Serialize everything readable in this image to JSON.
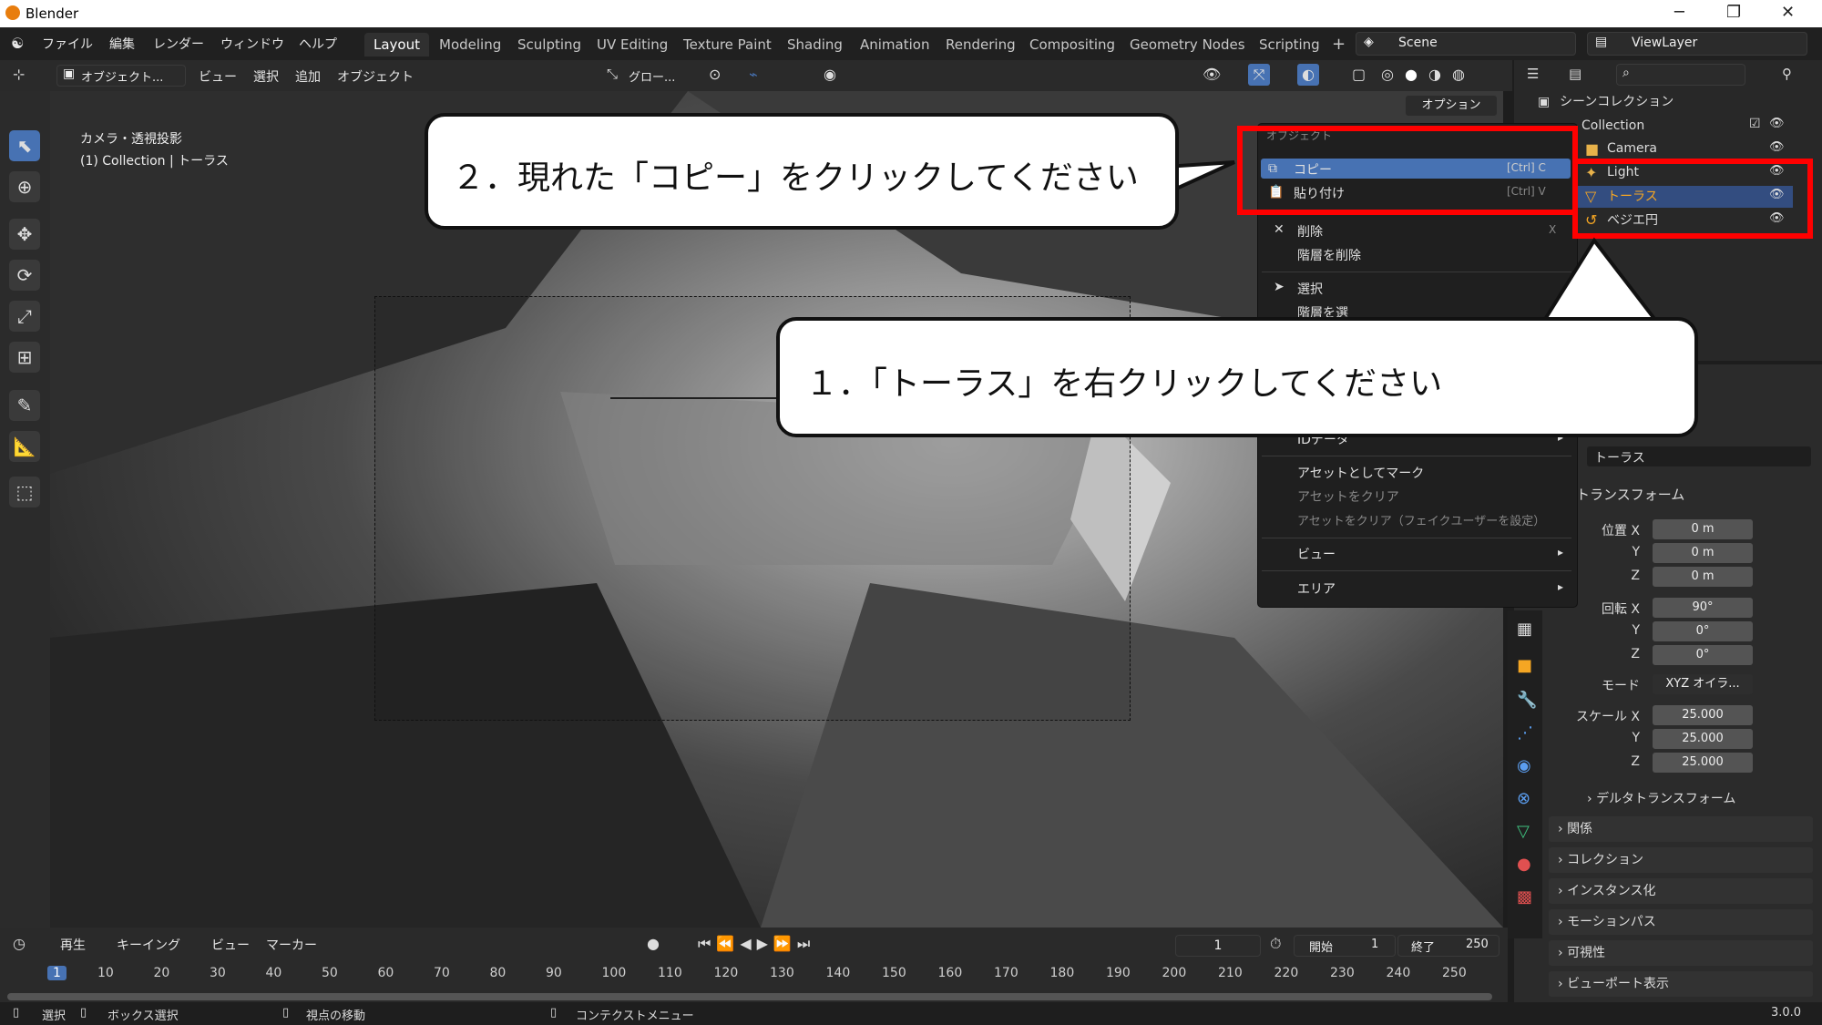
{
  "window": {
    "title": "Blender",
    "controls": [
      "─",
      "❐",
      "✕"
    ]
  },
  "menubar": {
    "menus": [
      "ファイル",
      "編集",
      "レンダー",
      "ウィンドウ",
      "ヘルプ"
    ],
    "workspaces": [
      "Layout",
      "Modeling",
      "Sculpting",
      "UV Editing",
      "Texture Paint",
      "Shading",
      "Animation",
      "Rendering",
      "Compositing",
      "Geometry Nodes",
      "Scripting"
    ],
    "active_workspace": "Layout",
    "add_tab": "+",
    "scene": "Scene",
    "view_layer": "ViewLayer"
  },
  "viewport_header": {
    "mode": "オブジェクト...",
    "menus": [
      "ビュー",
      "選択",
      "追加",
      "オブジェクト"
    ],
    "transform_orientation": "グロー...",
    "options": "オプション"
  },
  "viewport": {
    "info_line1": "カメラ・透視投影",
    "info_line2": "(1) Collection | トーラス"
  },
  "outliner": {
    "root": "シーンコレクション",
    "items": [
      {
        "label": "Collection",
        "icon": "collection-icon"
      },
      {
        "label": "Camera",
        "icon": "camera-icon"
      },
      {
        "label": "Light",
        "icon": "light-icon"
      },
      {
        "label": "トーラス",
        "icon": "mesh-icon",
        "selected": true
      },
      {
        "label": "ベジエ円",
        "icon": "curve-icon"
      }
    ]
  },
  "context_menu": {
    "title": "オブジェクト",
    "items": [
      {
        "label": "コピー",
        "shortcut": "[Ctrl] C",
        "highlight": true
      },
      {
        "label": "貼り付け",
        "shortcut": "[Ctrl] V"
      },
      {
        "label": "削除",
        "shortcut": "X"
      },
      {
        "label": "階層を削除"
      },
      {
        "label": "選択"
      },
      {
        "label": "階層を選"
      },
      {
        "label": "IDデータ",
        "submenu": true
      },
      {
        "label": "アセットとしてマーク"
      },
      {
        "label": "アセットをクリア"
      },
      {
        "label": "アセットをクリア（フェイクユーザーを設定）"
      },
      {
        "label": "ビュー",
        "submenu": true
      },
      {
        "label": "エリア",
        "submenu": true
      }
    ]
  },
  "properties": {
    "object_name": "トーラス",
    "transform_header": "トランスフォーム",
    "location": {
      "label": "位置",
      "x": "0 m",
      "y": "0 m",
      "z": "0 m"
    },
    "rotation": {
      "label": "回転",
      "x": "90°",
      "y": "0°",
      "z": "0°"
    },
    "mode_label": "モード",
    "mode_value": "XYZ オイラ...",
    "scale": {
      "label": "スケール",
      "x": "25.000",
      "y": "25.000",
      "z": "25.000"
    },
    "axis_x": "X",
    "axis_y": "Y",
    "axis_z": "Z",
    "panels": [
      "デルタトランスフォーム",
      "関係",
      "コレクション",
      "インスタンス化",
      "モーションパス",
      "可視性",
      "ビューポート表示"
    ]
  },
  "timeline": {
    "menus": [
      "再生",
      "キーイング",
      "ビュー",
      "マーカー"
    ],
    "current_frame": "1",
    "start_label": "開始",
    "start": "1",
    "end_label": "終了",
    "end": "250",
    "ticks": [
      "1",
      "10",
      "20",
      "30",
      "40",
      "50",
      "60",
      "70",
      "80",
      "90",
      "100",
      "110",
      "120",
      "130",
      "140",
      "150",
      "160",
      "170",
      "180",
      "190",
      "200",
      "210",
      "220",
      "230",
      "240",
      "250"
    ]
  },
  "statusbar": {
    "items": [
      "選択",
      "ボックス選択",
      "視点の移動",
      "コンテクストメニュー"
    ],
    "version": "3.0.0"
  },
  "annotations": {
    "step1": "１．「トーラス」を右クリックしてください",
    "step2": "２．現れた「コピー」をクリックしてください",
    "highlight_color": "#ff0000"
  }
}
